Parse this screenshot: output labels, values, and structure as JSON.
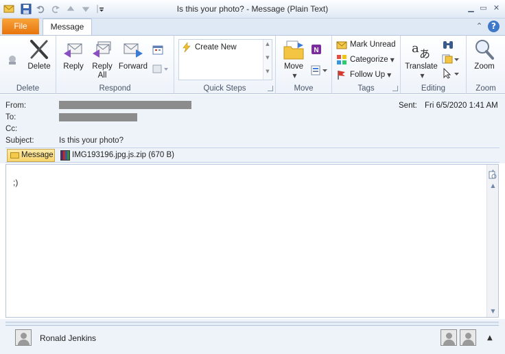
{
  "window": {
    "title": "Is this your photo?  -  Message (Plain Text)"
  },
  "tabs": {
    "file": "File",
    "message": "Message"
  },
  "ribbon": {
    "delete_group": {
      "label": "Delete",
      "delete_button": "Delete"
    },
    "respond_group": {
      "label": "Respond",
      "reply": "Reply",
      "reply_all_line1": "Reply",
      "reply_all_line2": "All",
      "forward": "Forward"
    },
    "quick_steps_group": {
      "label": "Quick Steps",
      "create_new": "Create New"
    },
    "move_group": {
      "label": "Move",
      "move_button": "Move"
    },
    "tags_group": {
      "label": "Tags",
      "mark_unread": "Mark Unread",
      "categorize": "Categorize",
      "follow_up": "Follow Up"
    },
    "editing_group": {
      "label": "Editing",
      "translate": "Translate"
    },
    "zoom_group": {
      "label": "Zoom",
      "zoom_button": "Zoom"
    }
  },
  "header": {
    "from_label": "From:",
    "to_label": "To:",
    "cc_label": "Cc:",
    "subject_label": "Subject:",
    "subject_value": "Is this your photo?",
    "sent_label": "Sent:",
    "sent_value": "Fri 6/5/2020 1:41 AM"
  },
  "attachments": {
    "message_button": "Message",
    "file": "IMG193196.jpg.js.zip (670 B)"
  },
  "body": {
    "text": ";)"
  },
  "people_pane": {
    "name": "Ronald Jenkins"
  },
  "colors": {
    "file_tab": "#e8740d",
    "ribbon_bg": "#eef3fa",
    "accent_blue": "#3f78c9"
  }
}
